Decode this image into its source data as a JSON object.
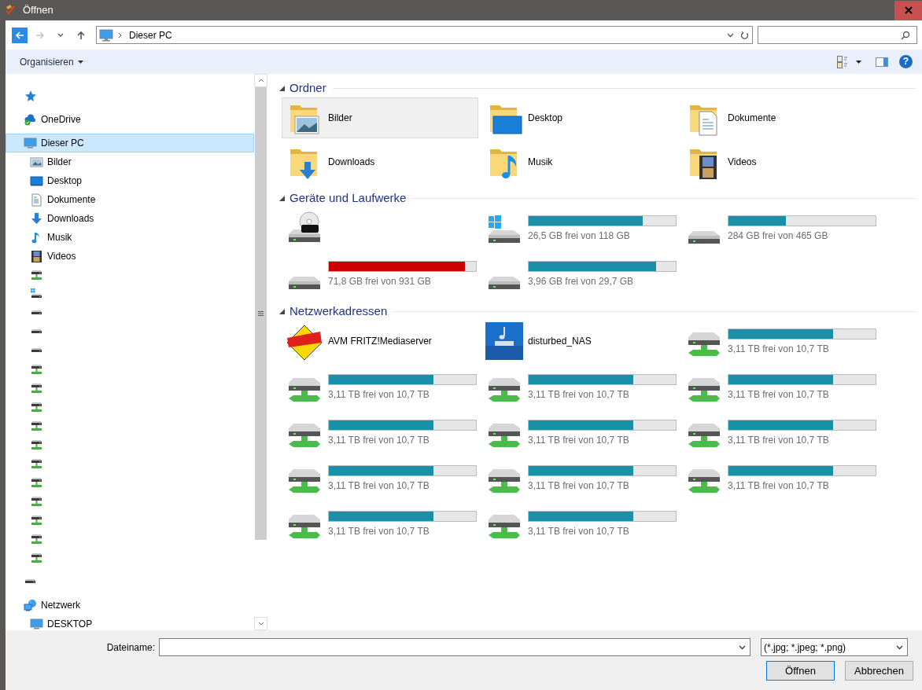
{
  "window": {
    "title": "Öffnen"
  },
  "nav_buttons": [
    {
      "kind": "back",
      "disabled": false
    },
    {
      "kind": "forward",
      "disabled": true
    },
    {
      "kind": "recent",
      "disabled": false
    },
    {
      "kind": "up",
      "disabled": false
    }
  ],
  "address": {
    "location": "Dieser PC"
  },
  "toolbar": {
    "organize": "Organisieren",
    "help": "?"
  },
  "nav": [
    {
      "kind": "quick-access",
      "selected": false
    },
    {
      "kind": "onedrive",
      "label": "OneDrive",
      "selected": false
    },
    {
      "kind": "this-pc",
      "label": "Dieser PC",
      "selected": true,
      "children": [
        {
          "kind": "pictures",
          "label": "Bilder",
          "selected": false
        },
        {
          "kind": "desktop",
          "label": "Desktop",
          "selected": false
        },
        {
          "kind": "documents",
          "label": "Dokumente",
          "selected": false
        },
        {
          "kind": "downloads",
          "label": "Downloads",
          "selected": false
        },
        {
          "kind": "music",
          "label": "Musik",
          "selected": false
        },
        {
          "kind": "videos",
          "label": "Videos",
          "selected": false
        },
        {
          "kind": "network-drive",
          "selected": false
        },
        {
          "kind": "system-drive",
          "selected": false
        },
        {
          "kind": "drive",
          "selected": false
        },
        {
          "kind": "drive",
          "selected": false
        },
        {
          "kind": "drive",
          "selected": false
        },
        {
          "kind": "network-drive",
          "selected": false
        },
        {
          "kind": "network-drive",
          "selected": false
        },
        {
          "kind": "network-drive",
          "selected": false
        },
        {
          "kind": "network-drive",
          "selected": false
        },
        {
          "kind": "network-drive",
          "selected": false
        },
        {
          "kind": "network-drive",
          "selected": false
        },
        {
          "kind": "network-drive",
          "selected": false
        },
        {
          "kind": "network-drive",
          "selected": false
        },
        {
          "kind": "network-drive",
          "selected": false
        },
        {
          "kind": "network-drive",
          "selected": false
        },
        {
          "kind": "network-drive",
          "selected": false
        }
      ]
    },
    {
      "kind": "drive",
      "selected": false
    },
    {
      "kind": "network",
      "label": "Netzwerk",
      "selected": false,
      "children": [
        {
          "kind": "computer",
          "label": "DESKTOP",
          "selected": false
        }
      ]
    }
  ],
  "sections": [
    {
      "title": "Ordner",
      "expanded": true,
      "items": [
        {
          "kind": "pictures-folder",
          "label": "Bilder",
          "selected": true
        },
        {
          "kind": "desktop-folder",
          "label": "Desktop",
          "selected": false
        },
        {
          "kind": "documents-folder",
          "label": "Dokumente",
          "selected": false
        },
        {
          "kind": "downloads-folder",
          "label": "Downloads",
          "selected": false
        },
        {
          "kind": "music-folder",
          "label": "Musik",
          "selected": false
        },
        {
          "kind": "videos-folder",
          "label": "Videos",
          "selected": false
        }
      ]
    },
    {
      "title": "Geräte und Laufwerke",
      "expanded": true,
      "items": [
        {
          "kind": "dvd-drive",
          "selected": false
        },
        {
          "kind": "system-drive",
          "selected": false,
          "level": 0.775,
          "reading": "26,5 GB frei von 118 GB",
          "color": "#1a8fa8"
        },
        {
          "kind": "drive",
          "selected": false,
          "level": 0.39,
          "reading": "284 GB frei von 465 GB",
          "color": "#1a8fa8"
        },
        {
          "kind": "drive",
          "selected": false,
          "level": 0.923,
          "reading": "71,8 GB frei von 931 GB",
          "color": "#cc0000"
        },
        {
          "kind": "drive",
          "selected": false,
          "level": 0.867,
          "reading": "3,96 GB frei von 29,7 GB",
          "color": "#1a8fa8"
        }
      ]
    },
    {
      "title": "Netzwerkadressen",
      "expanded": true,
      "items": [
        {
          "kind": "media-server",
          "label": "AVM FRITZ!Mediaserver",
          "selected": false
        },
        {
          "kind": "nas",
          "label": "disturbed_NAS",
          "selected": false
        },
        {
          "kind": "network-drive",
          "selected": false,
          "level": 0.709,
          "reading": "3,11 TB frei von 10,7 TB",
          "color": "#1a8fa8"
        },
        {
          "kind": "network-drive",
          "selected": false,
          "level": 0.709,
          "reading": "3,11 TB frei von 10,7 TB",
          "color": "#1a8fa8"
        },
        {
          "kind": "network-drive",
          "selected": false,
          "level": 0.709,
          "reading": "3,11 TB frei von 10,7 TB",
          "color": "#1a8fa8"
        },
        {
          "kind": "network-drive",
          "selected": false,
          "level": 0.709,
          "reading": "3,11 TB frei von 10,7 TB",
          "color": "#1a8fa8"
        },
        {
          "kind": "network-drive",
          "selected": false,
          "level": 0.709,
          "reading": "3,11 TB frei von 10,7 TB",
          "color": "#1a8fa8"
        },
        {
          "kind": "network-drive",
          "selected": false,
          "level": 0.709,
          "reading": "3,11 TB frei von 10,7 TB",
          "color": "#1a8fa8"
        },
        {
          "kind": "network-drive",
          "selected": false,
          "level": 0.709,
          "reading": "3,11 TB frei von 10,7 TB",
          "color": "#1a8fa8"
        },
        {
          "kind": "network-drive",
          "selected": false,
          "level": 0.709,
          "reading": "3,11 TB frei von 10,7 TB",
          "color": "#1a8fa8"
        },
        {
          "kind": "network-drive",
          "selected": false,
          "level": 0.709,
          "reading": "3,11 TB frei von 10,7 TB",
          "color": "#1a8fa8"
        },
        {
          "kind": "network-drive",
          "selected": false,
          "level": 0.709,
          "reading": "3,11 TB frei von 10,7 TB",
          "color": "#1a8fa8"
        },
        {
          "kind": "network-drive",
          "selected": false,
          "level": 0.709,
          "reading": "3,11 TB frei von 10,7 TB",
          "color": "#1a8fa8"
        },
        {
          "kind": "network-drive",
          "selected": false,
          "level": 0.709,
          "reading": "3,11 TB frei von 10,7 TB",
          "color": "#1a8fa8"
        }
      ]
    }
  ],
  "filename": {
    "label": "Dateiname:"
  },
  "filter": {
    "value": "(*.jpg; *.jpeg; *.png)"
  },
  "buttons": [
    {
      "label": "Öffnen",
      "default": true
    },
    {
      "label": "Abbrechen",
      "default": false
    }
  ]
}
